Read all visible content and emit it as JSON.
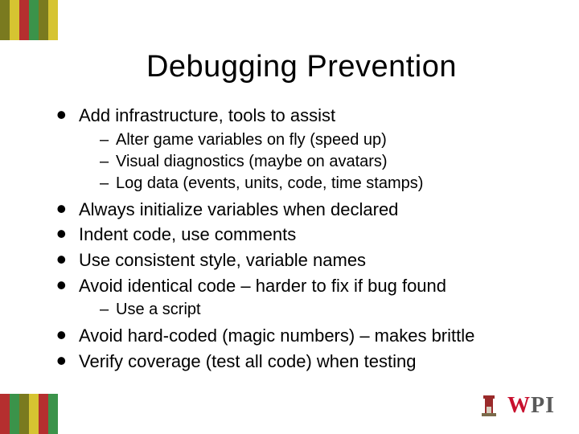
{
  "title": "Debugging Prevention",
  "stripes": {
    "top": [
      "#7a7a1f",
      "#d6c431",
      "#b52f2f",
      "#3b934a",
      "#7a7a1f",
      "#d6c431"
    ],
    "bottom": [
      "#b52f2f",
      "#3b934a",
      "#7a7a1f",
      "#d6c431",
      "#b52f2f",
      "#3b934a"
    ]
  },
  "bullets": [
    {
      "text": "Add infrastructure, tools to assist",
      "sub": [
        "Alter game variables on fly (speed up)",
        "Visual diagnostics  (maybe on avatars)",
        "Log data (events, units, code, time stamps)"
      ]
    },
    {
      "text": "Always initialize variables when declared"
    },
    {
      "text": "Indent code, use comments"
    },
    {
      "text": "Use consistent style, variable names"
    },
    {
      "text": "Avoid identical code – harder to fix if bug found",
      "sub": [
        "Use a script"
      ]
    },
    {
      "text": "Avoid hard-coded (magic numbers) – makes brittle"
    },
    {
      "text": "Verify coverage (test all code) when testing"
    }
  ],
  "logo": {
    "letters": [
      "W",
      "P",
      "I"
    ]
  }
}
